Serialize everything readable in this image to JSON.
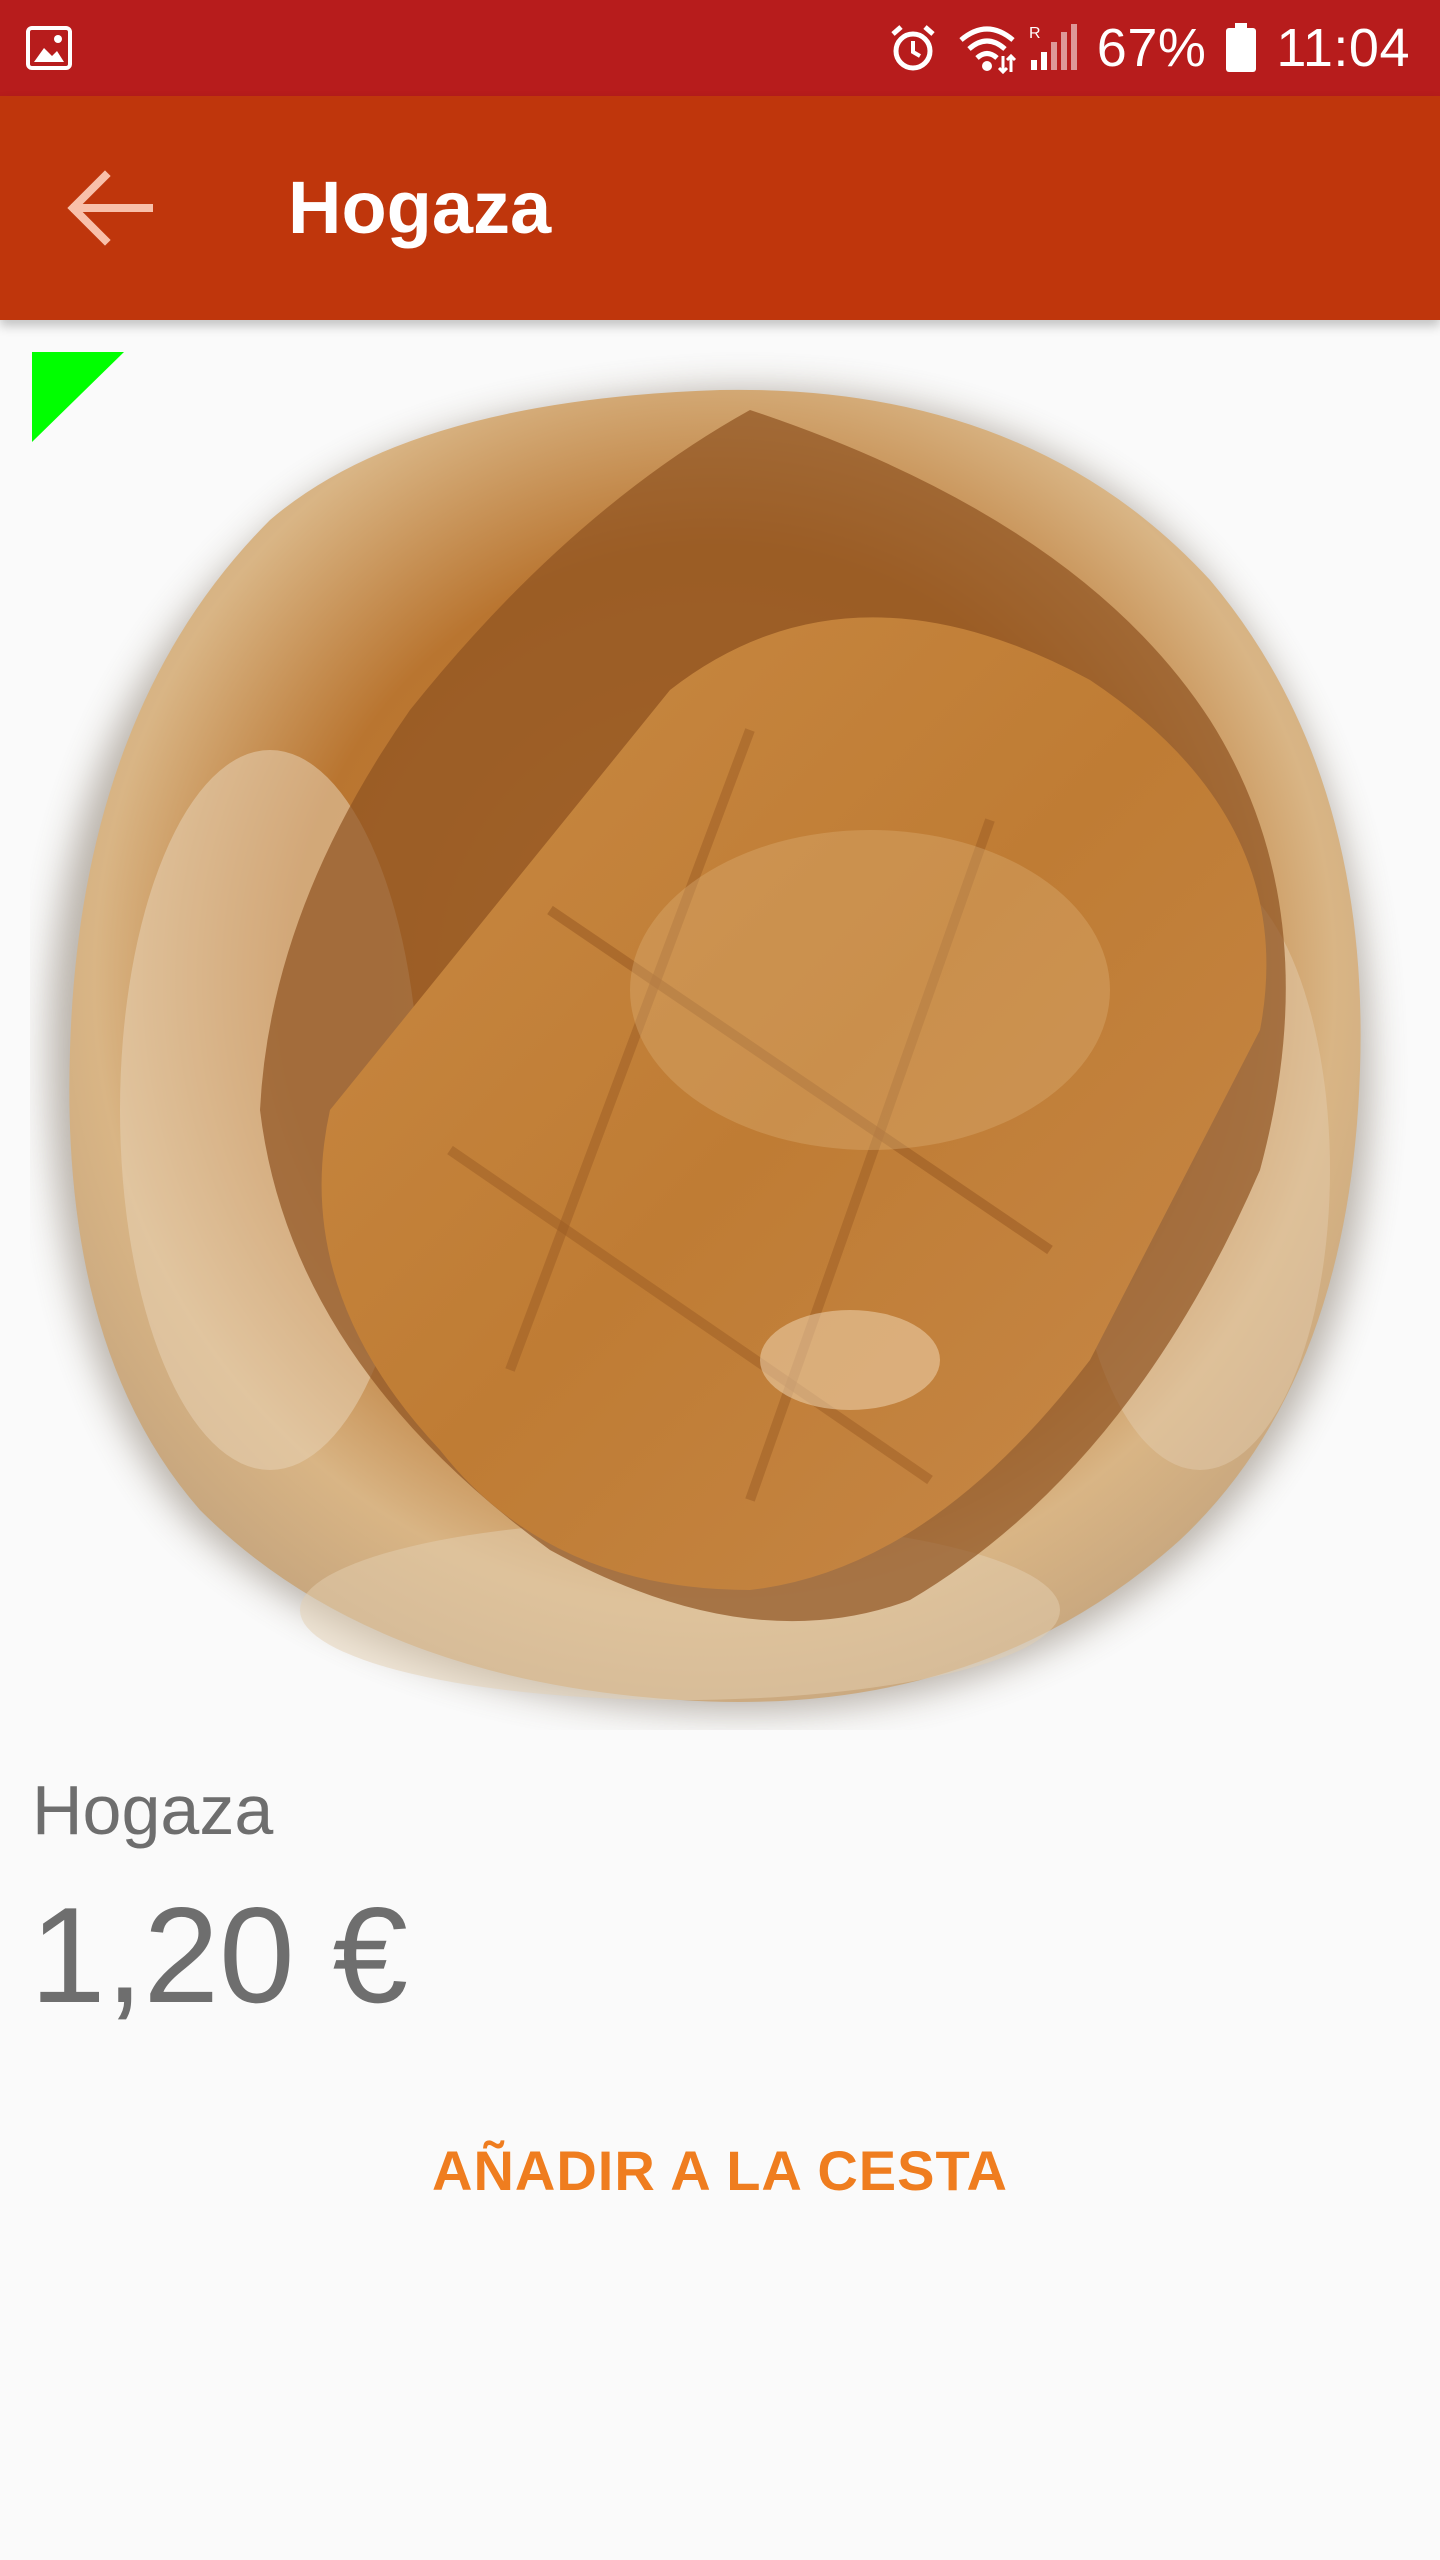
{
  "status_bar": {
    "battery_percent": "67%",
    "time": "11:04",
    "icons": [
      "gallery-notification-icon",
      "alarm-icon",
      "wifi-icon",
      "signal-icon",
      "battery-icon"
    ]
  },
  "app_bar": {
    "title": "Hogaza",
    "back_icon": "arrow-left-icon"
  },
  "product": {
    "name": "Hogaza",
    "price": "1,20 €",
    "image": "bread-loaf-image"
  },
  "actions": {
    "add_to_cart_label": "AÑADIR A LA CESTA"
  },
  "colors": {
    "status_bar": "#b71c1c",
    "app_bar": "#bf360c",
    "accent": "#ef7d1f",
    "flag": "#00ff00"
  }
}
